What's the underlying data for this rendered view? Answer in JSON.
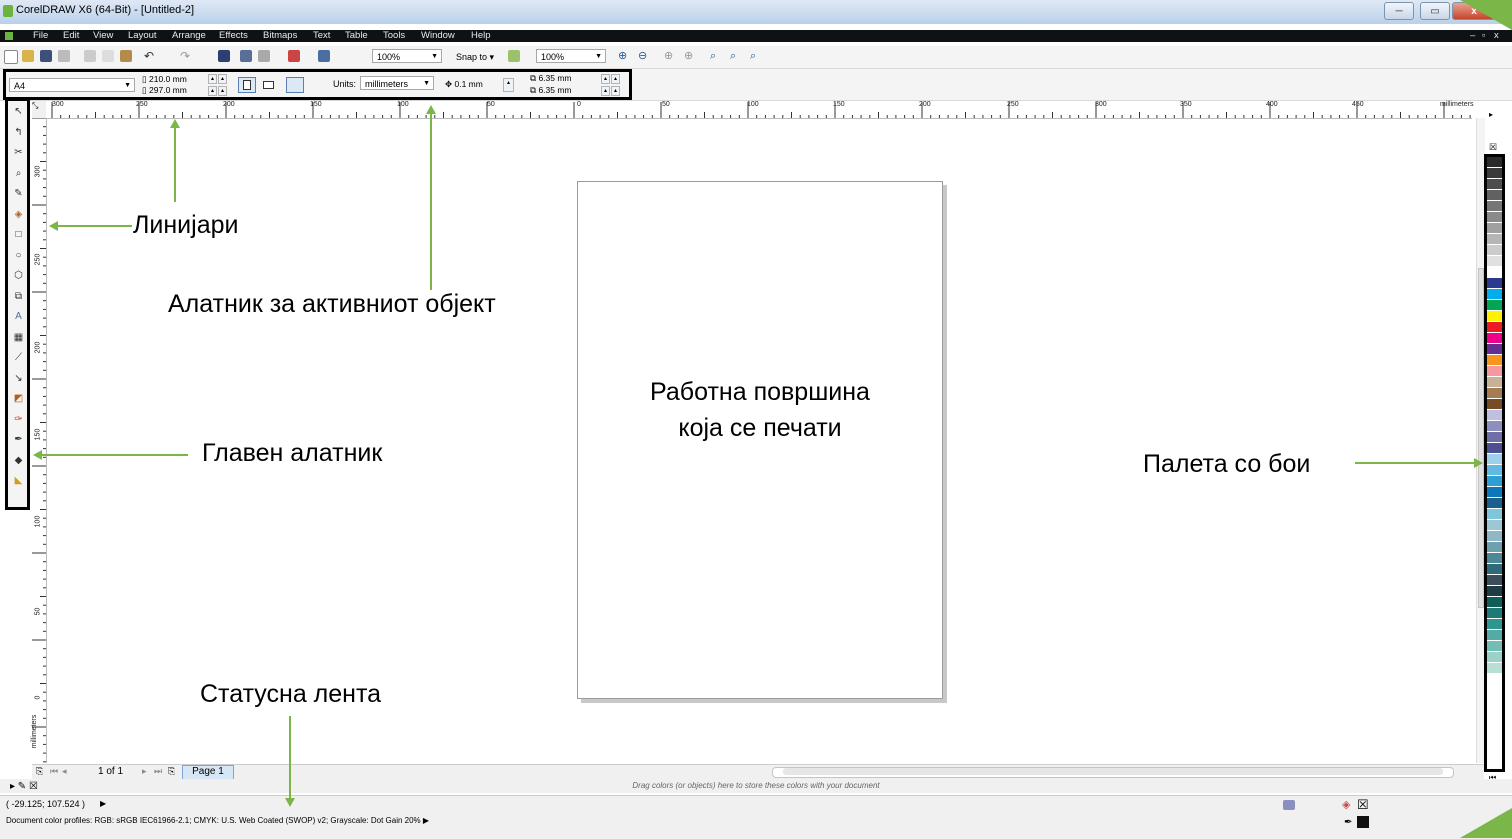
{
  "window": {
    "title": "CorelDRAW X6 (64-Bit) - [Untitled-2]",
    "min": "─",
    "restore": "▭",
    "close": "x"
  },
  "menu": [
    "File",
    "Edit",
    "View",
    "Layout",
    "Arrange",
    "Effects",
    "Bitmaps",
    "Text",
    "Table",
    "Tools",
    "Window",
    "Help"
  ],
  "toolbar": {
    "zoom1": "100%",
    "snap": "Snap to",
    "zoom2": "100%"
  },
  "propbar": {
    "paper": "A4",
    "width": "210.0 mm",
    "height": "297.0 mm",
    "units_label": "Units:",
    "units_value": "millimeters",
    "nudge": "0.1 mm",
    "dup_x": "6.35 mm",
    "dup_y": "6.35 mm"
  },
  "ruler": {
    "h_ticks": [
      "300",
      "250",
      "200",
      "150",
      "100",
      "50",
      "0",
      "50",
      "100",
      "150",
      "200",
      "250",
      "300",
      "350",
      "400",
      "450"
    ],
    "h_unit": "millimeters",
    "v_ticks": [
      "300",
      "250",
      "200",
      "150",
      "100",
      "50",
      "0"
    ],
    "v_unit": "millimeters"
  },
  "pagebar": {
    "counter": "1 of 1",
    "tab": "Page 1"
  },
  "drag_hint": "Drag colors (or objects) here to store these colors with your document",
  "status": {
    "coords": "( -29.125; 107.524 )",
    "profiles": "Document color profiles: RGB: sRGB IEC61966-2.1; CMYK: U.S. Web Coated (SWOP) v2; Grayscale: Dot Gain 20%"
  },
  "annotations": {
    "rulers": "Линијари",
    "propbar": "Алатник за активниот објект",
    "page_line1": "Работна површина",
    "page_line2": "која се печати",
    "toolbox": "Главен алатник",
    "palette": "Палета со бои",
    "statusbar": "Статусна лента"
  },
  "palette_colors": [
    "#2a2a2a",
    "#3a3a3a",
    "#4d4d4d",
    "#616161",
    "#767676",
    "#8a8a8a",
    "#a0a0a0",
    "#b5b5b5",
    "#cbcbcb",
    "#e0e0e0",
    "#ffffff",
    "#2b3990",
    "#00aeef",
    "#00a651",
    "#fff200",
    "#ed1c24",
    "#ec008c",
    "#662d91",
    "#f7941d",
    "#f6989d",
    "#c7b299",
    "#a67c52",
    "#754c24",
    "#bfbfdf",
    "#8f8fbf",
    "#6f6fa8",
    "#4f4f90",
    "#9fd0ea",
    "#61b8e0",
    "#2e9fd4",
    "#0b79b8",
    "#1b5f8c",
    "#7fc6dc",
    "#9ec7d6",
    "#8fb8c6",
    "#6ea0b0",
    "#4d8898",
    "#2f6a7a",
    "#3c4d57",
    "#1f3b44",
    "#0f5e5a",
    "#1e7a74",
    "#2d968e",
    "#56aaa5",
    "#73bdb6",
    "#9ad1c8",
    "#b8ded6"
  ],
  "colors": {
    "annotation_green": "#7ab648",
    "menubar": "#0f1215",
    "page_tab": "#d7e6f5"
  }
}
